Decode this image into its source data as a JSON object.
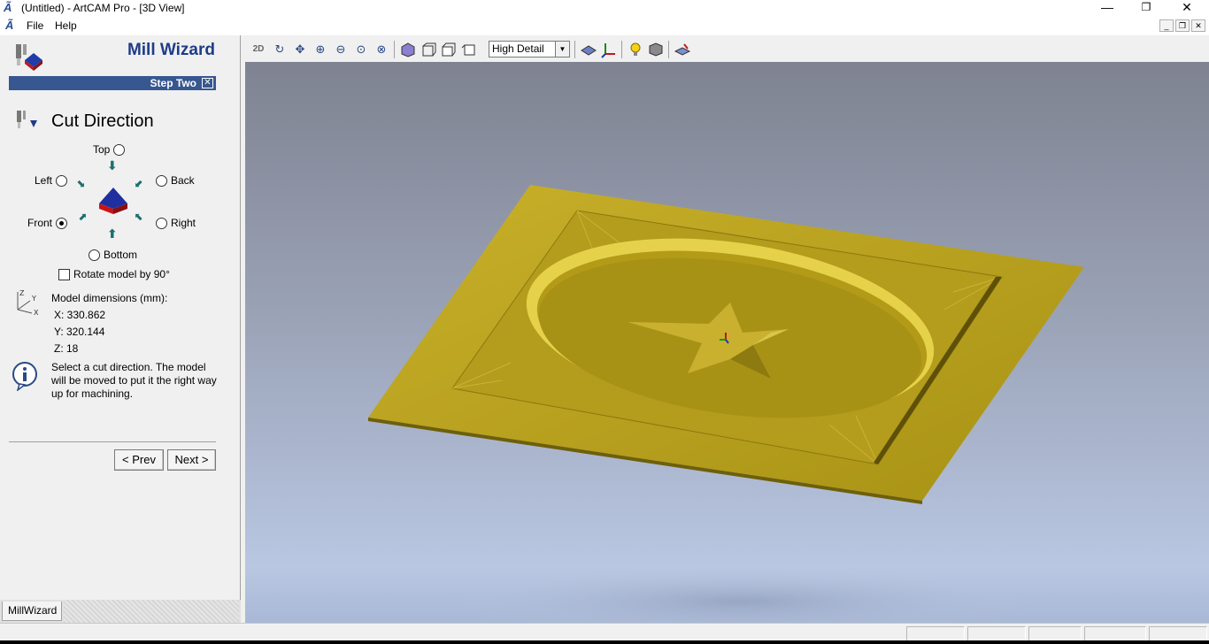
{
  "window": {
    "title": "(Untitled) - ArtCAM Pro - [3D View]",
    "app_icon": "artcam-logo-icon",
    "minimize_glyph": "—",
    "restore_glyph": "❐",
    "close_glyph": "✕"
  },
  "menu": {
    "items": [
      "File",
      "Help"
    ],
    "mdi_minimize": "_",
    "mdi_restore": "❐",
    "mdi_close": "✕"
  },
  "wizard": {
    "title": "Mill Wizard",
    "step_label": "Step Two",
    "step_close": "✕",
    "section_title": "Cut Direction",
    "directions": {
      "top": "Top",
      "left": "Left",
      "back": "Back",
      "front": "Front",
      "right": "Right",
      "bottom": "Bottom"
    },
    "selected_direction": "front",
    "rotate_label": "Rotate model by 90°",
    "rotate_checked": false,
    "dimensions_label": "Model dimensions (mm):",
    "dim_x": "X: 330.862",
    "dim_y": "Y: 320.144",
    "dim_z": "Z: 18",
    "axis_z": "Z",
    "axis_y": "Y",
    "axis_x": "X",
    "info_text": "Select a cut direction. The model will be moved to put it the right way up for machining.",
    "prev_button": "< Prev",
    "next_button": "Next >"
  },
  "panel_tabs": [
    "MillWizard"
  ],
  "toolbar": {
    "detail_value": "High Detail",
    "detail_dropdown_glyph": "▼",
    "buttons": [
      "2D",
      "↻",
      "✥",
      "⊕",
      "⊖",
      "⊙",
      "⊗"
    ]
  },
  "colors": {
    "accent": "#36578f",
    "title_blue": "#1f3c88",
    "model_gold": "#b9a21a",
    "viewport_top": "#7f8391",
    "viewport_bottom": "#b9c7e2"
  }
}
